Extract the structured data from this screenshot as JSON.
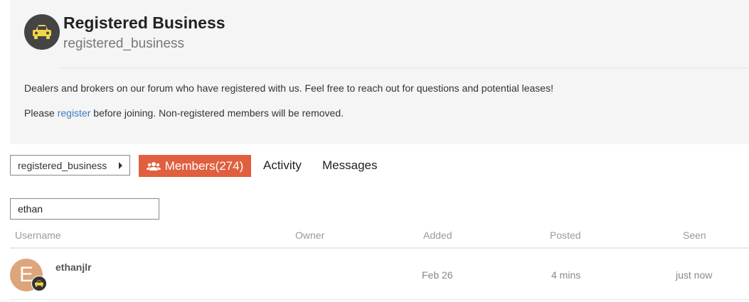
{
  "group": {
    "title": "Registered Business",
    "slug": "registered_business",
    "description": "Dealers and brokers on our forum who have registered with us. Feel free to reach out for questions and potential leases!",
    "notice_prefix": "Please ",
    "notice_link": "register",
    "notice_suffix": " before joining. Non-registered members will be removed.",
    "icon": "car-icon"
  },
  "nav": {
    "breadcrumb": "registered_business",
    "tabs": {
      "members": "Members(274)",
      "activity": "Activity",
      "messages": "Messages"
    }
  },
  "search": {
    "value": "ethan"
  },
  "table": {
    "columns": {
      "username": "Username",
      "owner": "Owner",
      "added": "Added",
      "posted": "Posted",
      "seen": "Seen"
    },
    "rows": [
      {
        "avatar_letter": "E",
        "username": "ethanjlr",
        "owner": "",
        "added": "Feb 26",
        "posted": "4 mins",
        "seen": "just now"
      }
    ]
  },
  "colors": {
    "accent": "#e05f3e",
    "link": "#3b7bbf",
    "car_yellow": "#f3d34a"
  }
}
